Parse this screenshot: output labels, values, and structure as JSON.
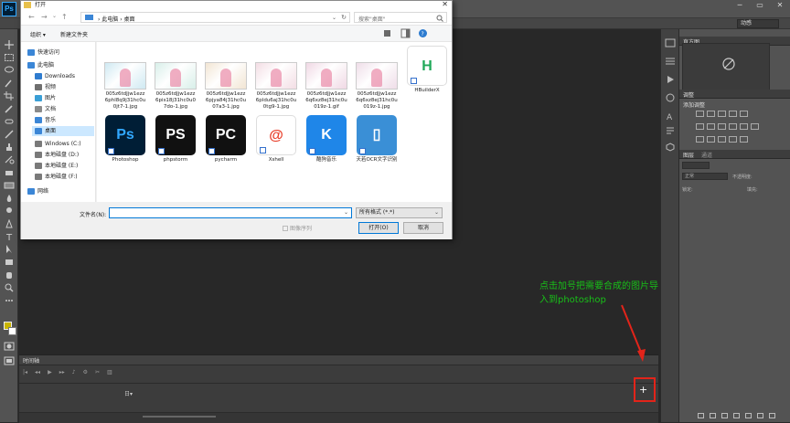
{
  "app": {
    "logo": "Ps",
    "workspace": "动感"
  },
  "dialog": {
    "title": "打开",
    "close": "✕",
    "nav": {
      "back": "←",
      "forward": "→",
      "recent": "⌄",
      "up": "↑"
    },
    "address": {
      "path": "› 此电脑 › 桌面",
      "dropdown": "⌄",
      "refresh": "↻"
    },
    "search_placeholder": "搜索\"桌面\"",
    "commands": {
      "organize": "组织 ▾",
      "new_folder": "新建文件夹"
    },
    "sidebar": [
      {
        "label": "快速访问",
        "icon": "star-icon",
        "color": "#3b86d6"
      },
      {
        "label": "此电脑",
        "icon": "computer-icon",
        "color": "#3b86d6"
      },
      {
        "label": "Downloads",
        "icon": "download-icon",
        "color": "#2f7ccf"
      },
      {
        "label": "视频",
        "icon": "video-icon",
        "color": "#6f6f6f"
      },
      {
        "label": "图片",
        "icon": "picture-icon",
        "color": "#3a9fd6"
      },
      {
        "label": "文档",
        "icon": "document-icon",
        "color": "#8a8a8a"
      },
      {
        "label": "音乐",
        "icon": "music-icon",
        "color": "#3b86d6"
      },
      {
        "label": "桌面",
        "icon": "desktop-icon",
        "color": "#3b86d6",
        "selected": true
      },
      {
        "label": "Windows (C:)",
        "icon": "drive-icon",
        "color": "#7a7a7a"
      },
      {
        "label": "本地磁盘 (D:)",
        "icon": "drive-icon",
        "color": "#7a7a7a"
      },
      {
        "label": "本地磁盘 (E:)",
        "icon": "drive-icon",
        "color": "#7a7a7a"
      },
      {
        "label": "本地磁盘 (F:)",
        "icon": "drive-icon",
        "color": "#7a7a7a"
      },
      {
        "label": "网络",
        "icon": "network-icon",
        "color": "#3b86d6"
      }
    ],
    "files": [
      {
        "l1": "005z6tdJjw1ezz",
        "l2": "6phl8q9j31hc0u",
        "l3": "0jt7-1.jpg",
        "color": "#cfe9f2"
      },
      {
        "l1": "005z6tdJjw1ezz",
        "l2": "6pis18j31hc0u0",
        "l3": "7do-1.jpg",
        "color": "#d8efe9"
      },
      {
        "l1": "005z6tdJjw1ezz",
        "l2": "6pjya84j31hc0u",
        "l3": "07a3-1.jpg",
        "color": "#f2e5d3"
      },
      {
        "l1": "005z6tdJjw1ezz",
        "l2": "6pldu6aj31hc0u",
        "l3": "0tg9-1.jpg",
        "color": "#f3dde4"
      },
      {
        "l1": "005z6tdJjw1ezz",
        "l2": "6q6xz8ej31hc0u",
        "l3": "019z-1.gif",
        "color": "#f0d8e4"
      },
      {
        "l1": "005z6tdJjw1ezz",
        "l2": "6q6xz8ej31hc0u",
        "l3": "019z-1.jpg",
        "color": "#efdde8"
      }
    ],
    "apps": [
      {
        "label": "HBuilderX",
        "glyph": "H",
        "bg": "#ffffff",
        "fg": "#21a95a"
      },
      {
        "label": "Photoshop",
        "glyph": "Ps",
        "bg": "#001e36",
        "fg": "#31a8ff"
      },
      {
        "label": "phpstorm",
        "glyph": "PS",
        "bg": "#111111",
        "fg": "#ffffff"
      },
      {
        "label": "pycharm",
        "glyph": "PC",
        "bg": "#111111",
        "fg": "#ffffff"
      },
      {
        "label": "Xshell",
        "glyph": "@",
        "bg": "#ffffff",
        "fg": "#e8402c"
      },
      {
        "label": "酷狗音乐",
        "glyph": "K",
        "bg": "#1f86e8",
        "fg": "#ffffff"
      },
      {
        "label": "天若OCR文字识别",
        "glyph": "▯",
        "bg": "#3a8fd6",
        "fg": "#ffffff"
      }
    ],
    "filename_label": "文件名(N):",
    "filename_value": "",
    "filetype": "所有格式 (*.*)",
    "sequence_label": "图像序列",
    "open_button": "打开(O)",
    "cancel_button": "取消"
  },
  "timeline": {
    "title": "时间轴",
    "zoom": "日▾",
    "add": "+"
  },
  "panels": {
    "navigator_tab": "直方图",
    "adjustments_tab": "调整",
    "add_adjustment": "添加调整",
    "layers_tab": "图层",
    "channels_tab": "通道",
    "blend_mode": "正常",
    "opacity": "不透明度:",
    "lock": "锁定:",
    "fill": "填充:"
  },
  "annotation": {
    "text": "点击加号把需要合成的图片导入到photoshop",
    "color": "#18c018"
  },
  "accent": {
    "highlight": "#e2241a",
    "select": "#cce8ff",
    "focus": "#0078d7"
  }
}
